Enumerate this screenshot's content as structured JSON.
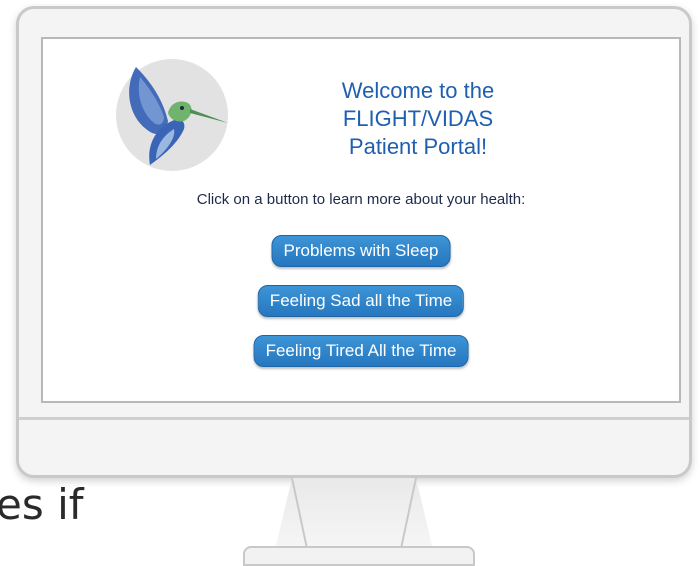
{
  "portal": {
    "welcome_lines": [
      "Welcome to the",
      "FLIGHT/VIDAS",
      "Patient Portal!"
    ],
    "prompt": "Click on a button to learn more about your health:",
    "buttons": [
      {
        "label": "Problems with Sleep"
      },
      {
        "label": "Feeling Sad all the Time"
      },
      {
        "label": "Feeling Tired All the Time"
      }
    ],
    "logo_icon": "hummingbird-icon"
  },
  "background_text": "es if",
  "colors": {
    "heading": "#1f5fb0",
    "button": "#2e86cc",
    "logo_circle": "#e2e2e2",
    "bird_wing": "#3a64b6",
    "bird_head": "#6fb36e"
  }
}
